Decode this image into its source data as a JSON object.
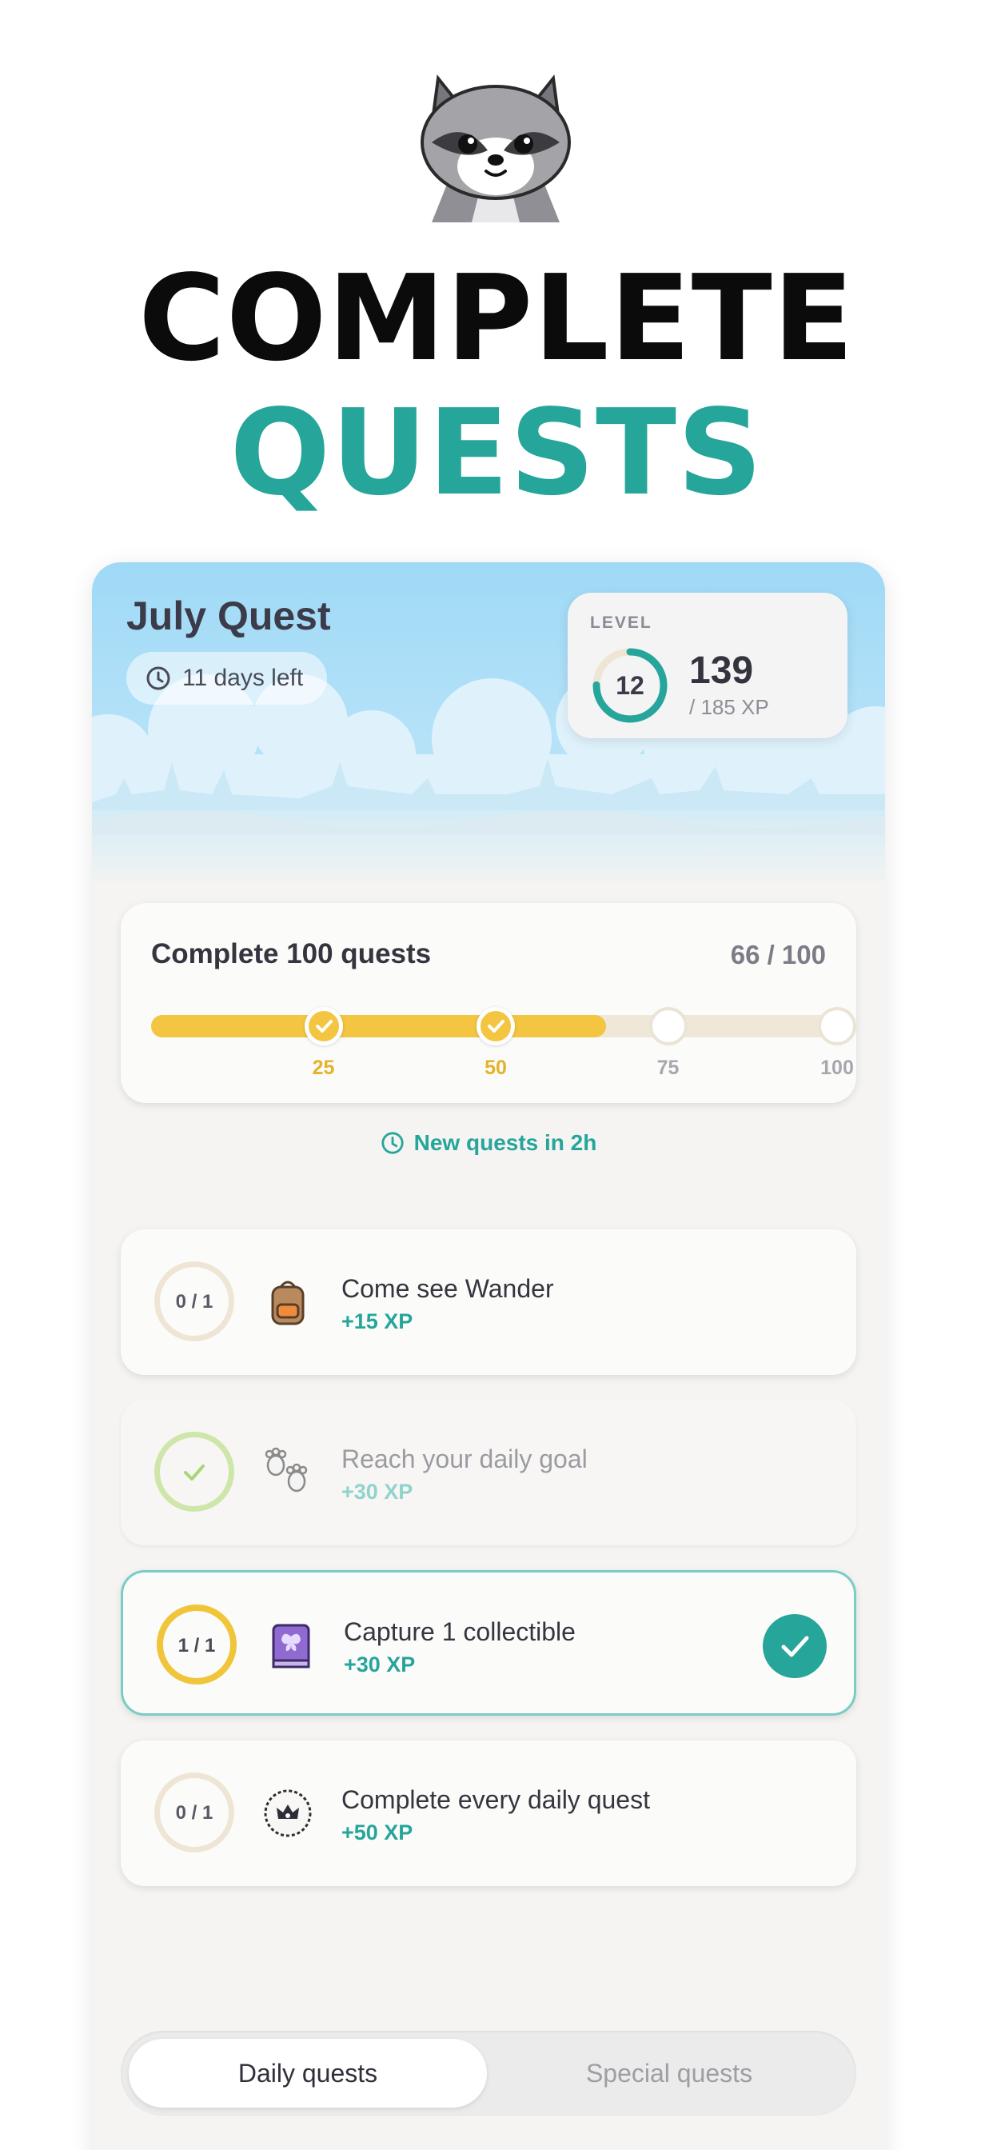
{
  "headline": {
    "line1": "COMPLETE",
    "line2": "QUESTS"
  },
  "quest_header": {
    "title": "July Quest",
    "time_left": "11 days left"
  },
  "level": {
    "label": "LEVEL",
    "number": "12",
    "xp": "139",
    "xp_total": "/ 185 XP",
    "progress": 0.7514
  },
  "monthly_challenge": {
    "title": "Complete 100 quests",
    "count": "66 / 100",
    "progress": 0.66,
    "milestones": [
      {
        "label": "25",
        "reached": true
      },
      {
        "label": "50",
        "reached": true
      },
      {
        "label": "75",
        "reached": false
      },
      {
        "label": "100",
        "reached": false
      }
    ]
  },
  "refresh_notice": "New quests in 2h",
  "quests": [
    {
      "progress": "0 / 1",
      "name": "Come see Wander",
      "xp": "+15 XP",
      "icon": "backpack-icon",
      "state": "open"
    },
    {
      "progress": "",
      "name": "Reach your daily goal",
      "xp": "+30 XP",
      "icon": "paw-prints-icon",
      "state": "claimed"
    },
    {
      "progress": "1 / 1",
      "name": "Capture 1 collectible",
      "xp": "+30 XP",
      "icon": "butterfly-book-icon",
      "state": "ready"
    },
    {
      "progress": "0 / 1",
      "name": "Complete every daily quest",
      "xp": "+50 XP",
      "icon": "crown-badge-icon",
      "state": "open"
    }
  ],
  "tabs": {
    "active": "Daily quests",
    "inactive": "Special quests"
  },
  "colors": {
    "accent": "#26a59a",
    "gold": "#f3c540",
    "sky": "#a6dcf6"
  }
}
